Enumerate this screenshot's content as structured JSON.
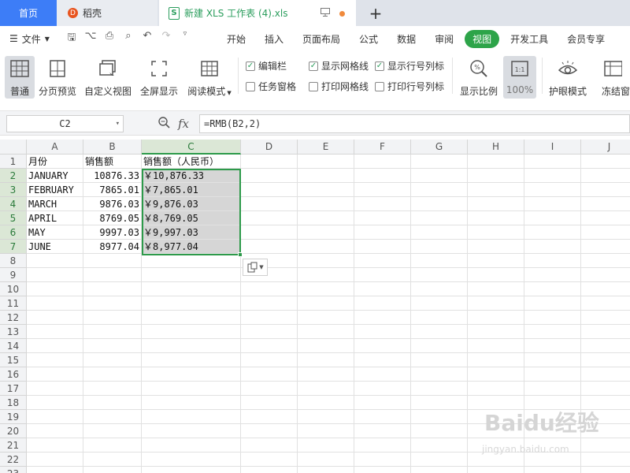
{
  "tabs": {
    "home": "首页",
    "daoke": "稻壳",
    "doc": "新建 XLS 工作表 (4).xls",
    "plus": "+"
  },
  "menu": {
    "file": "文件",
    "tabs": [
      "开始",
      "插入",
      "页面布局",
      "公式",
      "数据",
      "审阅",
      "视图",
      "开发工具",
      "会员专享"
    ],
    "active_tab": "视图"
  },
  "ribbon": {
    "normal": "普通",
    "page_break": "分页预览",
    "custom_view": "自定义视图",
    "fullscreen": "全屏显示",
    "reading": "阅读模式",
    "edit_bar": "编辑栏",
    "show_grid": "显示网格线",
    "show_headers": "显示行号列标",
    "task_pane": "任务窗格",
    "print_grid": "打印网格线",
    "print_headers": "打印行号列标",
    "zoom": "显示比例",
    "zoom_100": "100%",
    "eye_mode": "护眼模式",
    "freeze": "冻结窗"
  },
  "formula_bar": {
    "name_box": "C2",
    "fx": "fx",
    "formula": "=RMB(B2,2)"
  },
  "sheet": {
    "columns": [
      "A",
      "B",
      "C",
      "D",
      "E",
      "F",
      "G",
      "H",
      "I",
      "J"
    ],
    "rows": [
      "1",
      "2",
      "3",
      "4",
      "5",
      "6",
      "7",
      "8",
      "9",
      "10",
      "11",
      "12",
      "13",
      "14",
      "15",
      "16",
      "17",
      "18",
      "19",
      "20",
      "21",
      "22",
      "23"
    ],
    "data": [
      [
        "月份",
        "销售额",
        "销售额（人民币）"
      ],
      [
        "JANUARY",
        "10876.33",
        "￥10,876.33"
      ],
      [
        "FEBRUARY",
        "7865.01",
        "￥7,865.01"
      ],
      [
        "MARCH",
        "9876.03",
        "￥9,876.03"
      ],
      [
        "APRIL",
        "8769.05",
        "￥8,769.05"
      ],
      [
        "MAY",
        "9997.03",
        "￥9,997.03"
      ],
      [
        "JUNE",
        "8977.04",
        "￥8,977.04"
      ]
    ]
  },
  "watermark": {
    "line1": "Baidu经验",
    "line2": "jingyan.baidu.com"
  },
  "colors": {
    "accent_green": "#2da449",
    "home_tab_blue": "#3d7df7"
  }
}
